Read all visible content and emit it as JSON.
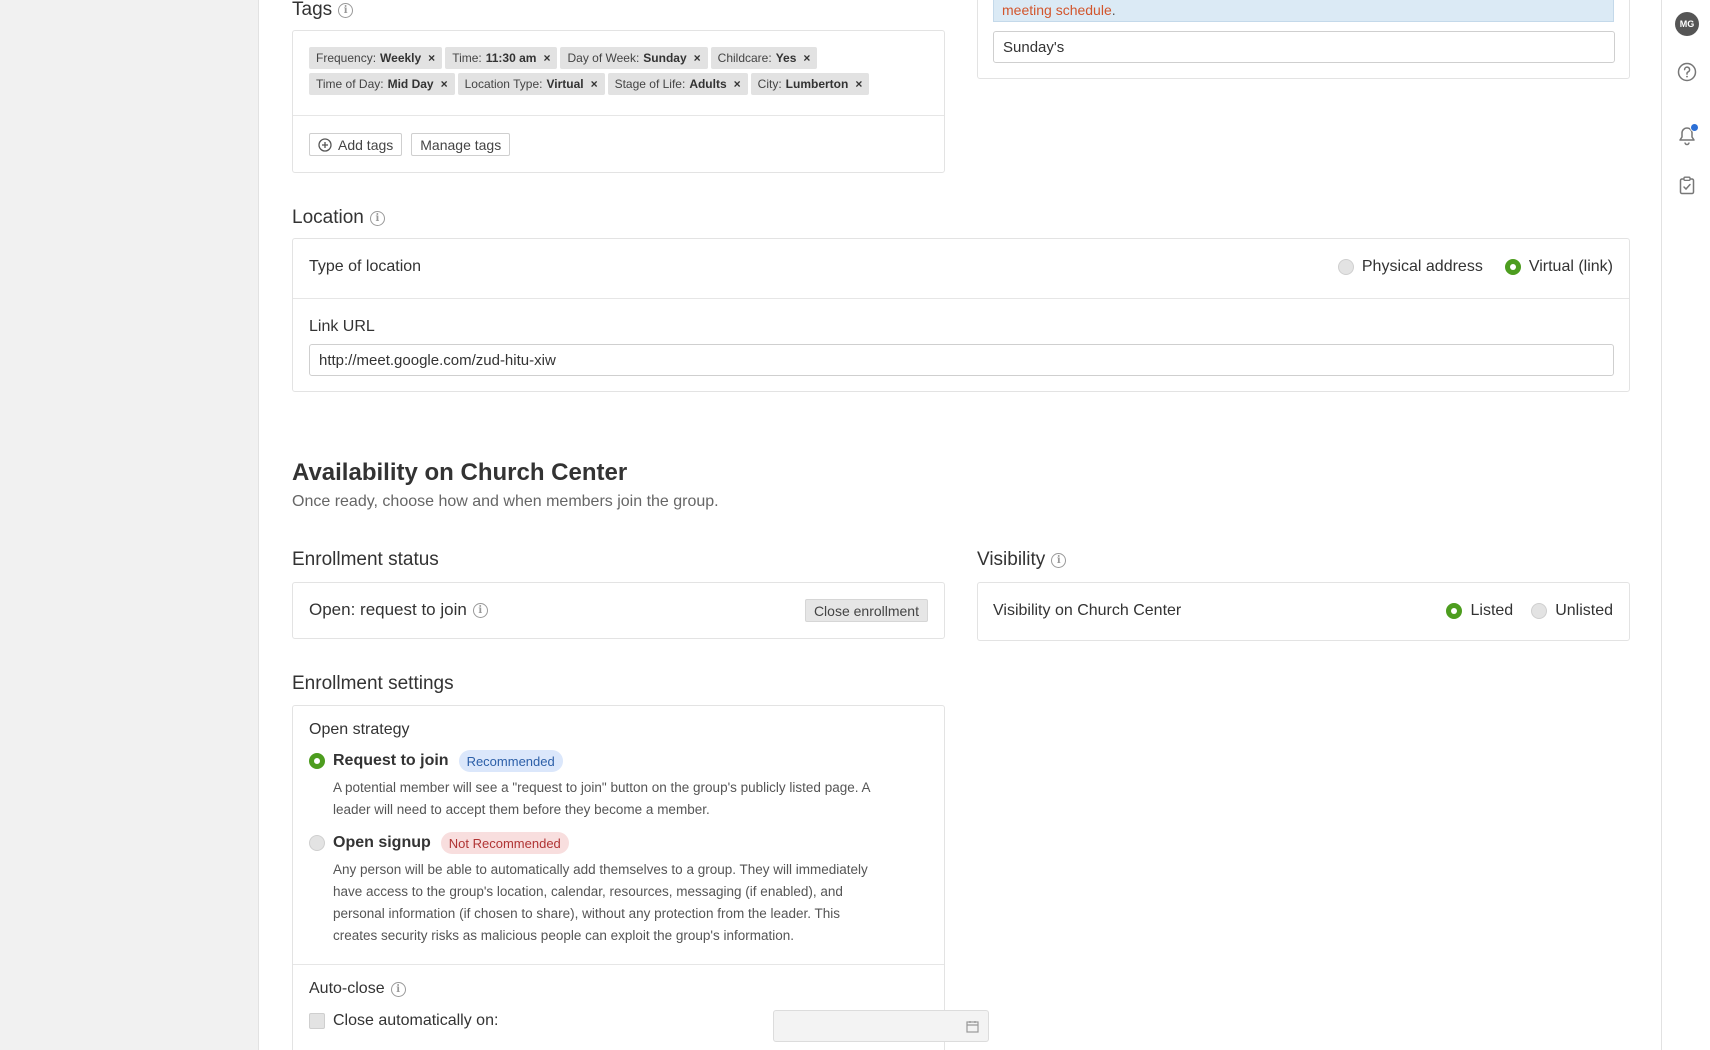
{
  "rail": {
    "avatar_initials": "MG"
  },
  "top_right": {
    "notice_text": "meeting schedule",
    "notice_period": ".",
    "name_input_value": "Sunday's"
  },
  "tags_section": {
    "title": "Tags",
    "tags": [
      {
        "key": "Frequency:",
        "value": "Weekly"
      },
      {
        "key": "Time:",
        "value": "11:30 am"
      },
      {
        "key": "Day of Week:",
        "value": "Sunday"
      },
      {
        "key": "Childcare:",
        "value": "Yes"
      },
      {
        "key": "Time of Day:",
        "value": "Mid Day"
      },
      {
        "key": "Location Type:",
        "value": "Virtual"
      },
      {
        "key": "Stage of Life:",
        "value": "Adults"
      },
      {
        "key": "City:",
        "value": "Lumberton"
      }
    ],
    "remove_glyph": "×",
    "add_tags_label": "Add tags",
    "manage_tags_label": "Manage tags"
  },
  "location_section": {
    "title": "Location",
    "type_label": "Type of location",
    "physical_label": "Physical address",
    "virtual_label": "Virtual (link)",
    "selected": "virtual",
    "link_label": "Link URL",
    "link_value": "http://meet.google.com/zud-hitu-xiw"
  },
  "availability": {
    "title": "Availability on Church Center",
    "subtitle": "Once ready, choose how and when members join the group."
  },
  "enrollment_status": {
    "title": "Enrollment status",
    "status_text": "Open: request to join",
    "close_button": "Close enrollment"
  },
  "visibility": {
    "title": "Visibility",
    "label": "Visibility on Church Center",
    "listed_label": "Listed",
    "unlisted_label": "Unlisted",
    "selected": "listed"
  },
  "enrollment_settings": {
    "title": "Enrollment settings",
    "strategy_label": "Open strategy",
    "options": [
      {
        "label": "Request to join",
        "badge": "Recommended",
        "selected": true,
        "desc_line1": "A potential member will see a \"request to join\" button on the group's publicly listed page. A",
        "desc_line2": "leader will need to accept them before they become a member."
      },
      {
        "label": "Open signup",
        "badge": "Not Recommended",
        "selected": false,
        "desc_line1": "Any person will be able to automatically add themselves to a group. They will immediately",
        "desc_line2": "have access to the group's location, calendar, resources, messaging (if enabled), and",
        "desc_line3": "personal information (if chosen to share), without any protection from the leader. This",
        "desc_line4": "creates security risks as malicious people can exploit the group's information."
      }
    ],
    "auto_close_label": "Auto-close",
    "close_auto_label": "Close automatically on:",
    "date_value": ""
  }
}
